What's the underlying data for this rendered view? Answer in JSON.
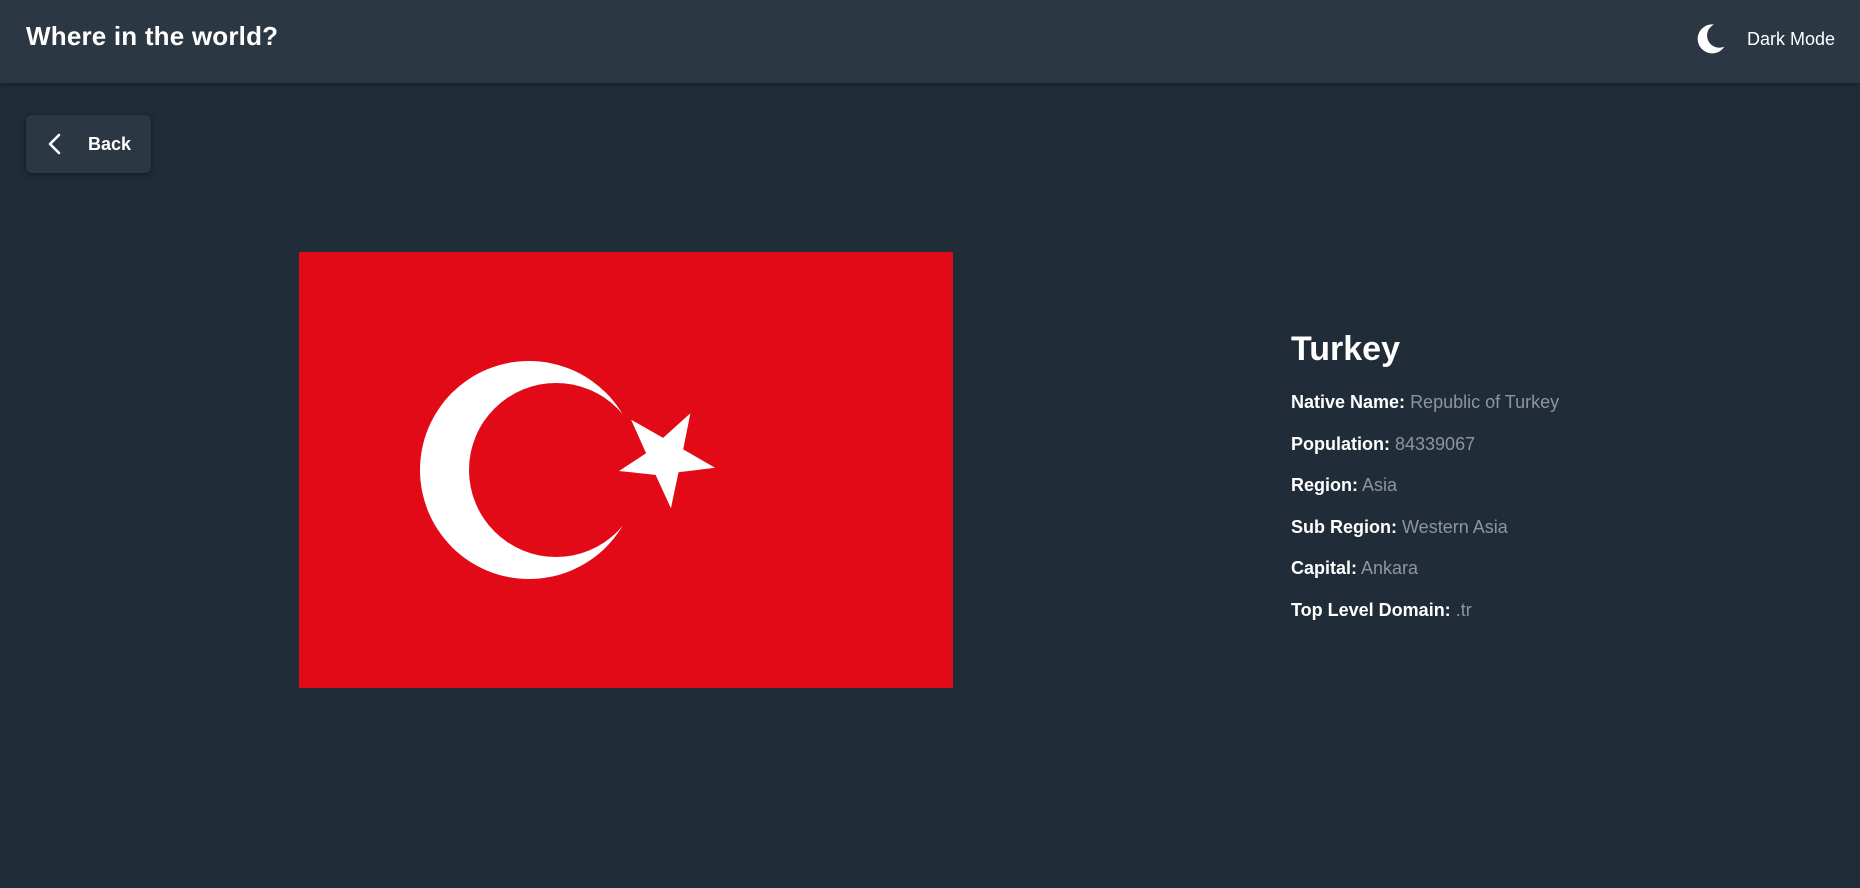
{
  "header": {
    "title": "Where in the world?",
    "theme_toggle_label": "Dark Mode",
    "theme_icon": "moon-icon"
  },
  "back_button": {
    "label": "Back",
    "icon": "chevron-left-icon"
  },
  "country": {
    "name": "Turkey",
    "flag": "turkey-flag",
    "fields": [
      {
        "label": "Native Name:",
        "value": "Republic of Turkey"
      },
      {
        "label": "Population:",
        "value": "84339067"
      },
      {
        "label": "Region:",
        "value": "Asia"
      },
      {
        "label": "Sub Region:",
        "value": "Western Asia"
      },
      {
        "label": "Capital:",
        "value": "Ankara"
      },
      {
        "label": "Top Level Domain:",
        "value": ".tr"
      }
    ]
  },
  "colors": {
    "background": "#202c37",
    "surface": "#2b3743",
    "text": "#ffffff",
    "muted_text": "#8e959c",
    "flag_red": "#e30a17",
    "flag_white": "#ffffff"
  }
}
